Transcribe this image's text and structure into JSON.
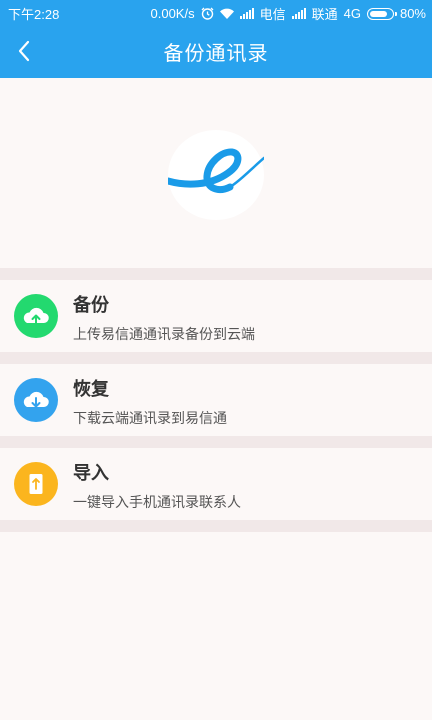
{
  "status_bar": {
    "time": "下午2:28",
    "speed": "0.00K/s",
    "carrier1": "电信",
    "carrier2": "联通",
    "network": "4G",
    "battery": "80%"
  },
  "header": {
    "title": "备份通讯录",
    "back_icon": "chevron-left-icon"
  },
  "logo": {
    "icon": "e-logo-icon",
    "colors": [
      "#1a9be8",
      "#ffffff"
    ]
  },
  "items": [
    {
      "label": "备份",
      "description": "上传易信通通讯录备份到云端",
      "icon": "cloud-upload-icon",
      "color": "#23d96f"
    },
    {
      "label": "恢复",
      "description": "下载云端通讯录到易信通",
      "icon": "cloud-download-icon",
      "color": "#33a3ee"
    },
    {
      "label": "导入",
      "description": "一键导入手机通讯录联系人",
      "icon": "import-phone-icon",
      "color": "#fbb51e"
    }
  ],
  "colors": {
    "header": "#29a3ee",
    "background": "#fcf8f7",
    "separator": "#f1e8e8"
  }
}
